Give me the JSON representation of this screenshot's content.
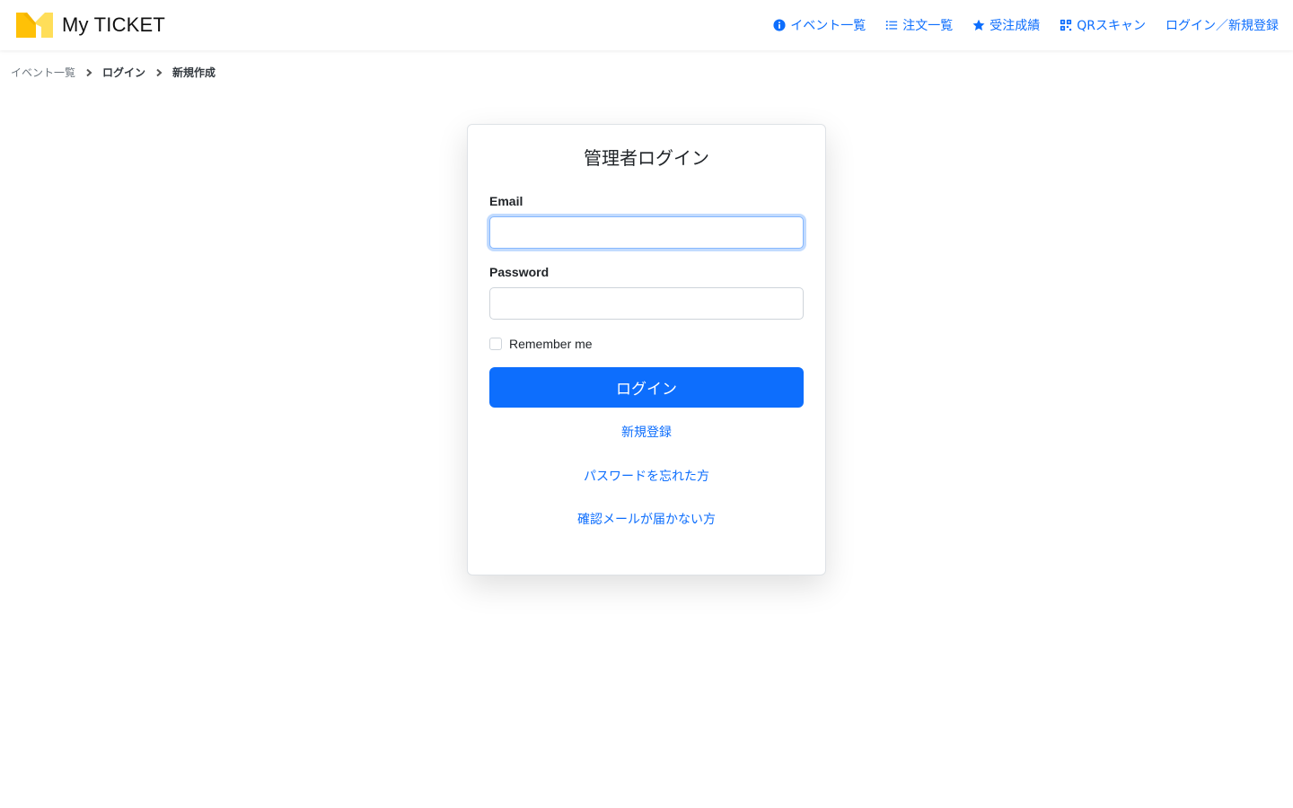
{
  "brand": {
    "name": "My TICKET",
    "logo_colors": [
      "#ffc107",
      "#ffde59"
    ]
  },
  "nav": {
    "items": [
      {
        "label": "イベント一覧",
        "icon": "info-circle-icon"
      },
      {
        "label": "注文一覧",
        "icon": "list-icon"
      },
      {
        "label": "受注成績",
        "icon": "star-icon"
      },
      {
        "label": "QRスキャン",
        "icon": "qr-code-icon"
      },
      {
        "label": "ログイン／新規登録",
        "icon": ""
      }
    ]
  },
  "breadcrumb": [
    "イベント一覧",
    "ログイン",
    "新規作成"
  ],
  "login": {
    "title": "管理者ログイン",
    "email_label": "Email",
    "email_value": "",
    "password_label": "Password",
    "password_value": "",
    "remember_label": "Remember me",
    "submit_label": "ログイン",
    "register_link": "新規登録",
    "forgot_link": "パスワードを忘れた方",
    "confirm_link": "確認メールが届かない方"
  },
  "colors": {
    "accent": "#0d6efd",
    "focus_ring": "#86b7fe"
  }
}
